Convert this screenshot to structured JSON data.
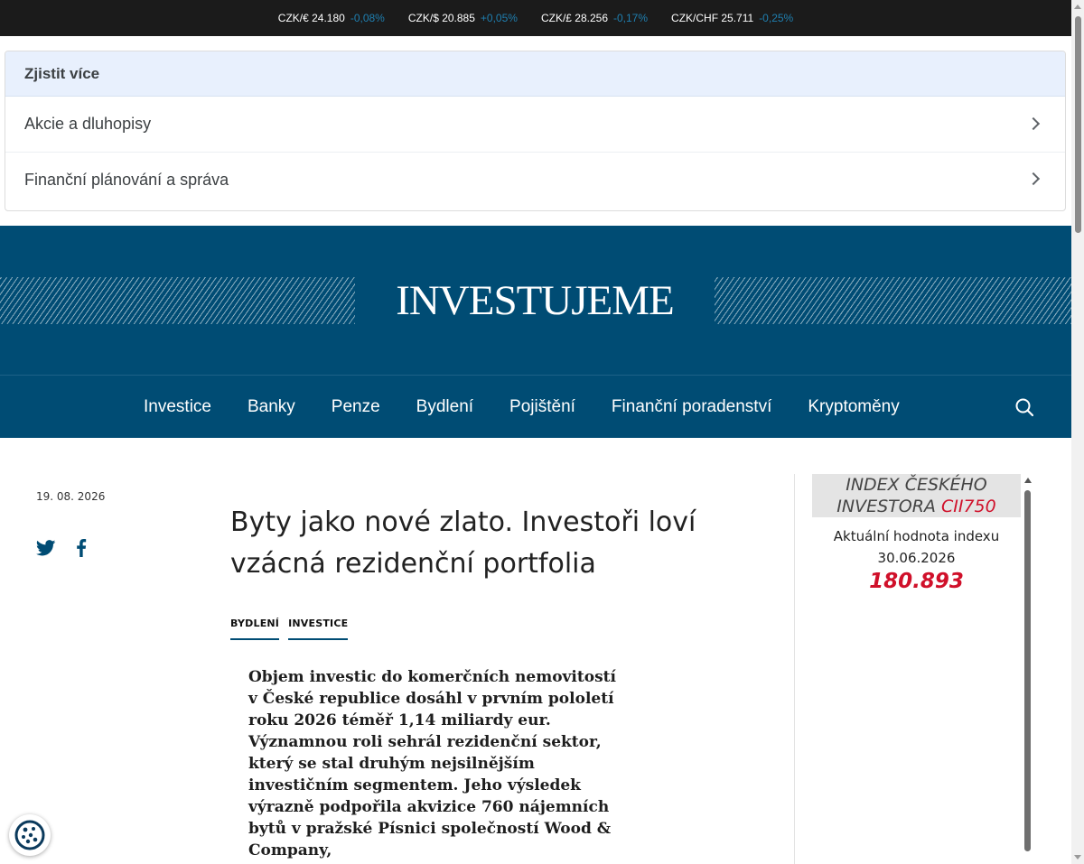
{
  "ticker": [
    {
      "pair": "CZK/€ 24.180",
      "change": "-0,08%",
      "dir": "down"
    },
    {
      "pair": "CZK/$ 20.885",
      "change": "+0,05%",
      "dir": "up"
    },
    {
      "pair": "CZK/£ 28.256",
      "change": "-0,17%",
      "dir": "down"
    },
    {
      "pair": "CZK/CHF 25.711",
      "change": "-0,25%",
      "dir": "down"
    }
  ],
  "learn_more": {
    "heading": "Zjistit více",
    "items": [
      "Akcie a dluhopisy",
      "Finanční plánování a správa"
    ]
  },
  "header": {
    "logo": "INVESTUJEME"
  },
  "nav": {
    "items": [
      "Investice",
      "Banky",
      "Penze",
      "Bydlení",
      "Pojištění",
      "Finanční poradenství",
      "Kryptoměny"
    ],
    "search_icon": "search-icon"
  },
  "article": {
    "date": "19. 08. 2026",
    "title": "Byty jako nové zlato. Investoři loví vzácná rezidenční portfolia",
    "tags": [
      "BYDLENÍ",
      "INVESTICE"
    ],
    "perex": "Objem investic do komerčních nemovitostí v České republice dosáhl v prvním pololetí roku 2026 téměř 1,14 miliardy eur. Významnou roli sehrál rezidenční sektor, který se stal druhým nejsilnějším investičním segmentem. Jeho výsledek výrazně podpořila akvizice 760 nájemních bytů v pražské Písnici společností Wood & Company,",
    "share": [
      "twitter-icon",
      "facebook-icon"
    ]
  },
  "sidebar": {
    "index_title": "INDEX ČESKÉHO INVESTORA",
    "index_code": "CII750",
    "label": "Aktuální hodnota indexu",
    "date": "30.06.2026",
    "value": "180.893"
  },
  "colors": {
    "brand": "#004c74",
    "accent_red": "#d0102a",
    "ticker_change": "#1f7fb0"
  }
}
